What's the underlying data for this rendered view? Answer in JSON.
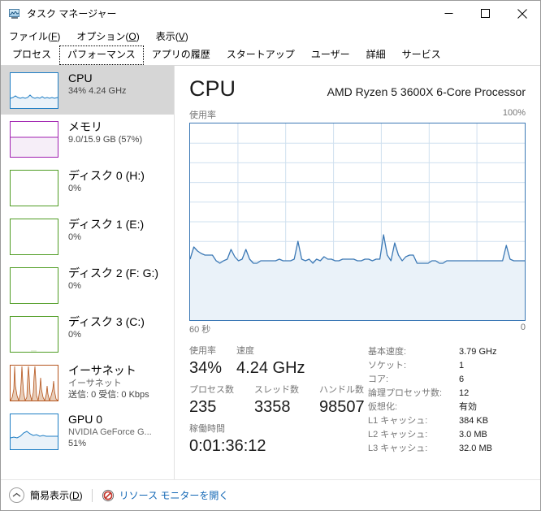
{
  "window": {
    "title": "タスク マネージャー",
    "icon": "task-manager-icon",
    "minimize": "—",
    "maximize": "□",
    "close": "✕"
  },
  "menu": [
    {
      "label": "ファイル(F)",
      "plain": "ファイル(",
      "accel": "F",
      "tail": ")"
    },
    {
      "label": "オプション(O)",
      "plain": "オプション(",
      "accel": "O",
      "tail": ")"
    },
    {
      "label": "表示(V)",
      "plain": "表示(",
      "accel": "V",
      "tail": ")"
    }
  ],
  "tabs": [
    {
      "label": "プロセス",
      "active": false
    },
    {
      "label": "パフォーマンス",
      "active": true
    },
    {
      "label": "アプリの履歴",
      "active": false
    },
    {
      "label": "スタートアップ",
      "active": false
    },
    {
      "label": "ユーザー",
      "active": false
    },
    {
      "label": "詳細",
      "active": false
    },
    {
      "label": "サービス",
      "active": false
    }
  ],
  "sidebar": {
    "items": [
      {
        "name": "cpu",
        "title": "CPU",
        "sub1": "34%  4.24 GHz",
        "sub2": "",
        "color": "#1d7dc4",
        "selected": true
      },
      {
        "name": "memory",
        "title": "メモリ",
        "sub1": "9.0/15.9 GB (57%)",
        "sub2": "",
        "color": "#a020b0",
        "selected": false
      },
      {
        "name": "disk-0",
        "title": "ディスク 0 (H:)",
        "sub1": "0%",
        "sub2": "",
        "color": "#4f9c23",
        "selected": false
      },
      {
        "name": "disk-1",
        "title": "ディスク 1 (E:)",
        "sub1": "0%",
        "sub2": "",
        "color": "#4f9c23",
        "selected": false
      },
      {
        "name": "disk-2",
        "title": "ディスク 2 (F: G:)",
        "sub1": "0%",
        "sub2": "",
        "color": "#4f9c23",
        "selected": false
      },
      {
        "name": "disk-3",
        "title": "ディスク 3 (C:)",
        "sub1": "0%",
        "sub2": "",
        "color": "#4f9c23",
        "selected": false
      },
      {
        "name": "ethernet",
        "title": "イーサネット",
        "sub1": "イーサネット",
        "sub2": "送信: 0 受信: 0 Kbps",
        "color": "#b5551d",
        "selected": false
      },
      {
        "name": "gpu-0",
        "title": "GPU 0",
        "sub1": "NVIDIA GeForce G...",
        "sub2": "51%",
        "color": "#1d7dc4",
        "selected": false
      }
    ]
  },
  "main": {
    "title": "CPU",
    "model": "AMD Ryzen 5 3600X 6-Core Processor",
    "graph_label_left": "使用率",
    "graph_label_right": "100%",
    "graph_foot_left": "60 秒",
    "graph_foot_right": "0",
    "stats_left": [
      {
        "label": "使用率",
        "value": "34%",
        "name": "utilization"
      },
      {
        "label": "速度",
        "value": "4.24 GHz",
        "name": "speed"
      },
      {
        "label": "プロセス数",
        "value": "235",
        "name": "processes"
      },
      {
        "label": "スレッド数",
        "value": "3358",
        "name": "threads"
      },
      {
        "label": "ハンドル数",
        "value": "98507",
        "name": "handles"
      },
      {
        "label": "稼働時間",
        "value": "0:01:36:12",
        "name": "uptime"
      }
    ],
    "specs": [
      {
        "key": "基本速度:",
        "val": "3.79 GHz"
      },
      {
        "key": "ソケット:",
        "val": "1"
      },
      {
        "key": "コア:",
        "val": "6"
      },
      {
        "key": "論理プロセッサ数:",
        "val": "12"
      },
      {
        "key": "仮想化:",
        "val": "有効"
      },
      {
        "key": "L1 キャッシュ:",
        "val": "384 KB"
      },
      {
        "key": "L2 キャッシュ:",
        "val": "3.0 MB"
      },
      {
        "key": "L3 キャッシュ:",
        "val": "32.0 MB"
      }
    ]
  },
  "statusbar": {
    "fewer_details": "簡易表示(D)",
    "fewer_plain": "簡易表示(",
    "fewer_accel": "D",
    "fewer_tail": ")",
    "resource_monitor": "リソース モニターを開く"
  },
  "colors": {
    "cpu_line": "#3b78b5",
    "cpu_fill": "#eaf2f9",
    "grid": "#cfe0ef",
    "link": "#1267b5",
    "selected_bg": "#d6d6d6"
  },
  "chart_data": {
    "type": "line",
    "title": "CPU 使用率",
    "xlabel": "60 秒",
    "ylabel": "使用率",
    "ylim": [
      0,
      100
    ],
    "xlim": [
      60,
      0
    ],
    "grid": true,
    "grid_cols": 6,
    "grid_rows": 10,
    "legend": "none",
    "series": [
      {
        "name": "CPU 使用率 (%)",
        "values": [
          31,
          37,
          35,
          34,
          33,
          33,
          33,
          30,
          29,
          30,
          31,
          36,
          32,
          30,
          31,
          36,
          31,
          29,
          29,
          30,
          30,
          30,
          30,
          30,
          31,
          30,
          30,
          30,
          31,
          40,
          31,
          30,
          31,
          29,
          31,
          30,
          32,
          31,
          31,
          30,
          30,
          31,
          31,
          31,
          31,
          30,
          30,
          31,
          31,
          30,
          31,
          31,
          44,
          34,
          30,
          39,
          33,
          30,
          32,
          33,
          33,
          29,
          29,
          29,
          29,
          30,
          30,
          29,
          29,
          30,
          30,
          30,
          30,
          30,
          30,
          30,
          30,
          30,
          30,
          30,
          30,
          30,
          30,
          30,
          30,
          38,
          31,
          30,
          30,
          30
        ]
      }
    ]
  }
}
